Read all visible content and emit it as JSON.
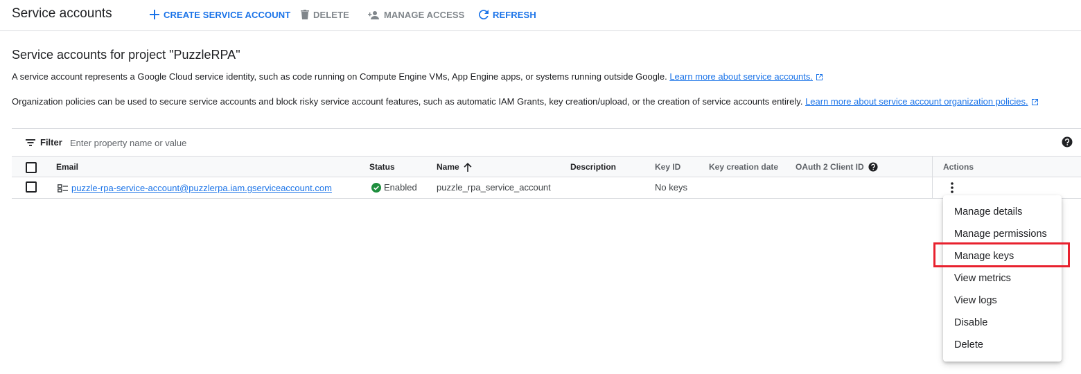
{
  "header": {
    "title": "Service accounts",
    "create_label": "CREATE SERVICE ACCOUNT",
    "delete_label": "DELETE",
    "manage_access_label": "MANAGE ACCESS",
    "refresh_label": "REFRESH"
  },
  "intro": {
    "title": "Service accounts for project \"PuzzleRPA\"",
    "para1": "A service account represents a Google Cloud service identity, such as code running on Compute Engine VMs, App Engine apps, or systems running outside Google. ",
    "para1_link": "Learn more about service accounts.",
    "para2": "Organization policies can be used to secure service accounts and block risky service account features, such as automatic IAM Grants, key creation/upload, or the creation of service accounts entirely. ",
    "para2_link": "Learn more about service account organization policies."
  },
  "filter": {
    "label": "Filter",
    "placeholder": "Enter property name or value"
  },
  "table": {
    "columns": {
      "email": "Email",
      "status": "Status",
      "name": "Name",
      "description": "Description",
      "key_id": "Key ID",
      "key_creation_date": "Key creation date",
      "oauth": "OAuth 2 Client ID",
      "actions": "Actions"
    },
    "rows": [
      {
        "email": "puzzle-rpa-service-account@puzzlerpa.iam.gserviceaccount.com",
        "status": "Enabled",
        "name": "puzzle_rpa_service_account",
        "description": "",
        "key_id": "No keys",
        "key_creation_date": "",
        "oauth": ""
      }
    ]
  },
  "menu": {
    "items": [
      "Manage details",
      "Manage permissions",
      "Manage keys",
      "View metrics",
      "View logs",
      "Disable",
      "Delete"
    ],
    "highlighted": "Manage keys"
  },
  "colors": {
    "accent": "#1a73e8",
    "disabled": "#80868b",
    "success": "#1e8e3e",
    "highlight": "#e8212e"
  },
  "icons": [
    "add-icon",
    "delete-icon",
    "manage-access-icon",
    "refresh-icon",
    "external-link-icon",
    "filter-icon",
    "help-icon",
    "sort-arrow-up-icon",
    "service-account-icon",
    "check-circle-icon",
    "more-vert-icon"
  ]
}
